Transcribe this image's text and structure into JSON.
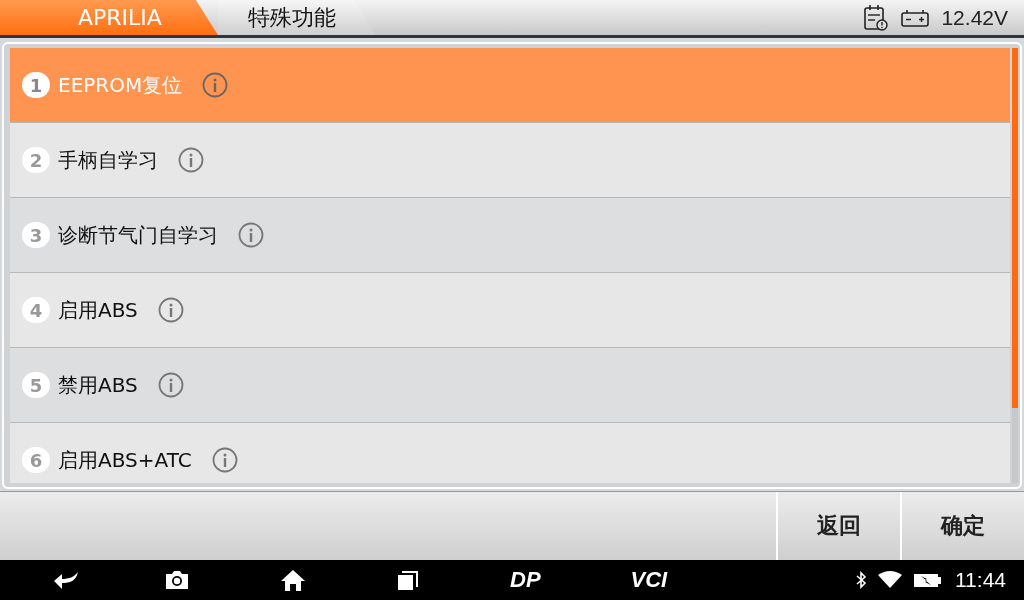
{
  "breadcrumb": [
    {
      "label": "APRILIA",
      "selected": true
    },
    {
      "label": "特殊功能",
      "selected": false
    }
  ],
  "status": {
    "voltage": "12.42V"
  },
  "functions": [
    {
      "number": "1",
      "label": "EEPROM复位",
      "selected": true
    },
    {
      "number": "2",
      "label": "手柄自学习",
      "selected": false
    },
    {
      "number": "3",
      "label": "诊断节气门自学习",
      "selected": false
    },
    {
      "number": "4",
      "label": "启用ABS",
      "selected": false
    },
    {
      "number": "5",
      "label": "禁用ABS",
      "selected": false
    },
    {
      "number": "6",
      "label": "启用ABS+ATC",
      "selected": false
    }
  ],
  "buttons": [
    "返回",
    "确定"
  ],
  "nav_bar": {
    "dp": "DP",
    "vci": "VCI",
    "time": "11:44"
  }
}
